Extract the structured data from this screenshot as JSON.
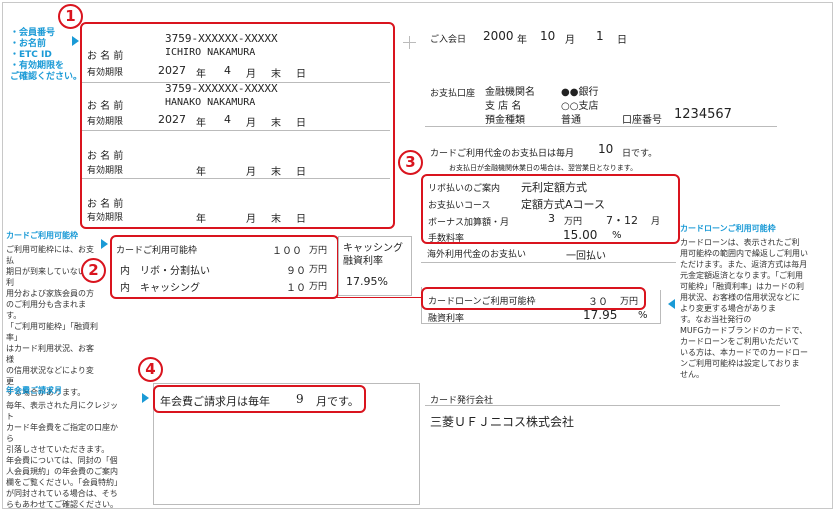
{
  "badges": {
    "b1": "1",
    "b2": "2",
    "b3": "3",
    "b4": "4"
  },
  "left_legend": [
    "・会員番号",
    "・お名前",
    "・ETC ID",
    "・有効期限を",
    "ご確認ください。"
  ],
  "cards": [
    {
      "number": "3759-XXXXXX-XXXXX",
      "name_label": "お 名 前",
      "name": "ICHIRO NAKAMURA",
      "expiry_label": "有効期限",
      "year": "2027",
      "year_unit": "年",
      "month": "4",
      "month_unit": "月",
      "end": "末",
      "day": "日"
    },
    {
      "number": "3759-XXXXXX-XXXXX",
      "name_label": "お 名 前",
      "name": "HANAKO NAKAMURA",
      "expiry_label": "有効期限",
      "year": "2027",
      "year_unit": "年",
      "month": "4",
      "month_unit": "月",
      "end": "末",
      "day": "日"
    },
    {
      "number": "",
      "name_label": "お 名 前",
      "name": "",
      "expiry_label": "有効期限",
      "year": "",
      "year_unit": "年",
      "month": "",
      "month_unit": "月",
      "end": "末",
      "day": "日"
    },
    {
      "number": "",
      "name_label": "お 名 前",
      "name": "",
      "expiry_label": "有効期限",
      "year": "",
      "year_unit": "年",
      "month": "",
      "month_unit": "月",
      "end": "末",
      "day": "日"
    }
  ],
  "join": {
    "label": "ご入会日",
    "year": "2000",
    "year_unit": "年",
    "month": "10",
    "month_unit": "月",
    "day": "1",
    "day_unit": "日"
  },
  "bank": {
    "label": "お支払口座",
    "bank_name_label": "金融機関名",
    "bank_name": "●●銀行",
    "branch_label": "支 店 名",
    "branch": "○○支店",
    "type_label": "預金種類",
    "type": "普通",
    "account_label": "口座番号",
    "account": "1234567"
  },
  "payday": {
    "text1": "カードご利用代金のお支払日は毎月",
    "day": "10",
    "text2": "日です。",
    "note": "お支払日が金融機関休業日の場合は、翌営業日となります。"
  },
  "revolving": {
    "row1_label": "リボ払いのご案内",
    "row1_value": "元利定額方式",
    "row2_label": "お支払いコース",
    "row2_value": "定額方式Aコース",
    "row3_label": "ボーナス加算額・月",
    "row3_amount": "3",
    "row3_unit": "万円",
    "row3_months": "7・12",
    "row3_month_unit": "月",
    "row4_label": "手数料率",
    "row4_value": "15.00",
    "row4_unit": "%"
  },
  "overseas": {
    "label": "海外利用代金のお支払い",
    "value": "一回払い"
  },
  "limits": {
    "title": "カードご利用可能枠",
    "total": "１００",
    "total_unit": "万円",
    "row1_prefix": "内",
    "row1_label": "リボ・分割払い",
    "row1_value": "９０",
    "row1_unit": "万円",
    "row2_prefix": "内",
    "row2_label": "キャッシング",
    "row2_value": "１０",
    "row2_unit": "万円"
  },
  "cashing": {
    "label1": "キャッシング",
    "label2": "融資利率",
    "rate": "17.95%"
  },
  "loan": {
    "label": "カードローンご利用可能枠",
    "value": "３０",
    "unit": "万円",
    "rate_label": "融資利率",
    "rate": "17.95",
    "rate_unit": "%"
  },
  "annual": {
    "text1": "年会費ご請求月は毎年",
    "month": "9",
    "text2": "月です。"
  },
  "issuer": {
    "label": "カード発行会社",
    "name": "三菱ＵＦＪニコス株式会社"
  },
  "note_limit": {
    "title": "カードご利用可能枠",
    "body": [
      "ご利用可能枠には、お支払",
      "期日が到来していないご利",
      "用分および家族会員の方",
      "のご利用分も含まれます。",
      "「ご利用可能枠」「融資利率」",
      "はカード利用状況、お客様",
      "の信用状況などにより変更",
      "する場合があります。"
    ]
  },
  "note_loan": {
    "title": "カードローンご利用可能枠",
    "body": [
      "カードローンは、表示されたご利",
      "用可能枠の範囲内で繰返しご利用い",
      "ただけます。また、返済方式は毎月",
      "元金定額返済となります。「ご利用",
      "可能枠」「融資利率」はカードの利",
      "用状況、お客様の信用状況などに",
      "より変更する場合がありま",
      "す。なお当社発行の",
      "MUFGカードブランドのカードで、",
      "カードローンをご利用いただいて",
      "いる方は、本カードでのカードロー",
      "ンご利用可能枠は設定しておりま",
      "せん。"
    ]
  },
  "note_annual": {
    "title": "年会費ご請求月",
    "body": [
      "毎年、表示された月にクレジット",
      "カード年会費をご指定の口座から",
      "引落しさせていただきます。",
      "年会費については、同封の「個",
      "人会員規約」の年会費のご案内",
      "欄をご覧ください。「会員特約」",
      "が同封されている場合は、そち",
      "らもあわせてご確認ください。"
    ]
  },
  "colors": {
    "accent_red": "#d9141e",
    "cyan": "#1a9ad6"
  }
}
